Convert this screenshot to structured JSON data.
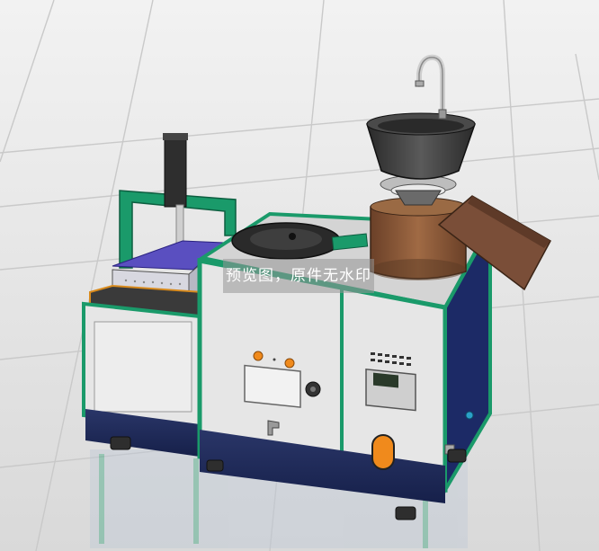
{
  "watermark": {
    "text": "预览图，原件无水印"
  },
  "scene": {
    "subject": "soy-milk-tofu-machine-render",
    "colors": {
      "frame_green": "#1a9a6a",
      "panel_light": "#e6e6e6",
      "base_navy": "#1f2a5a",
      "tray_purple": "#5a4fc0",
      "drum_brown": "#8a5a38",
      "chute_brown": "#7a4e38",
      "hopper_dark": "#3a3a3a",
      "indicator_orange": "#f08a1c",
      "background": "#e7e7e7"
    }
  }
}
